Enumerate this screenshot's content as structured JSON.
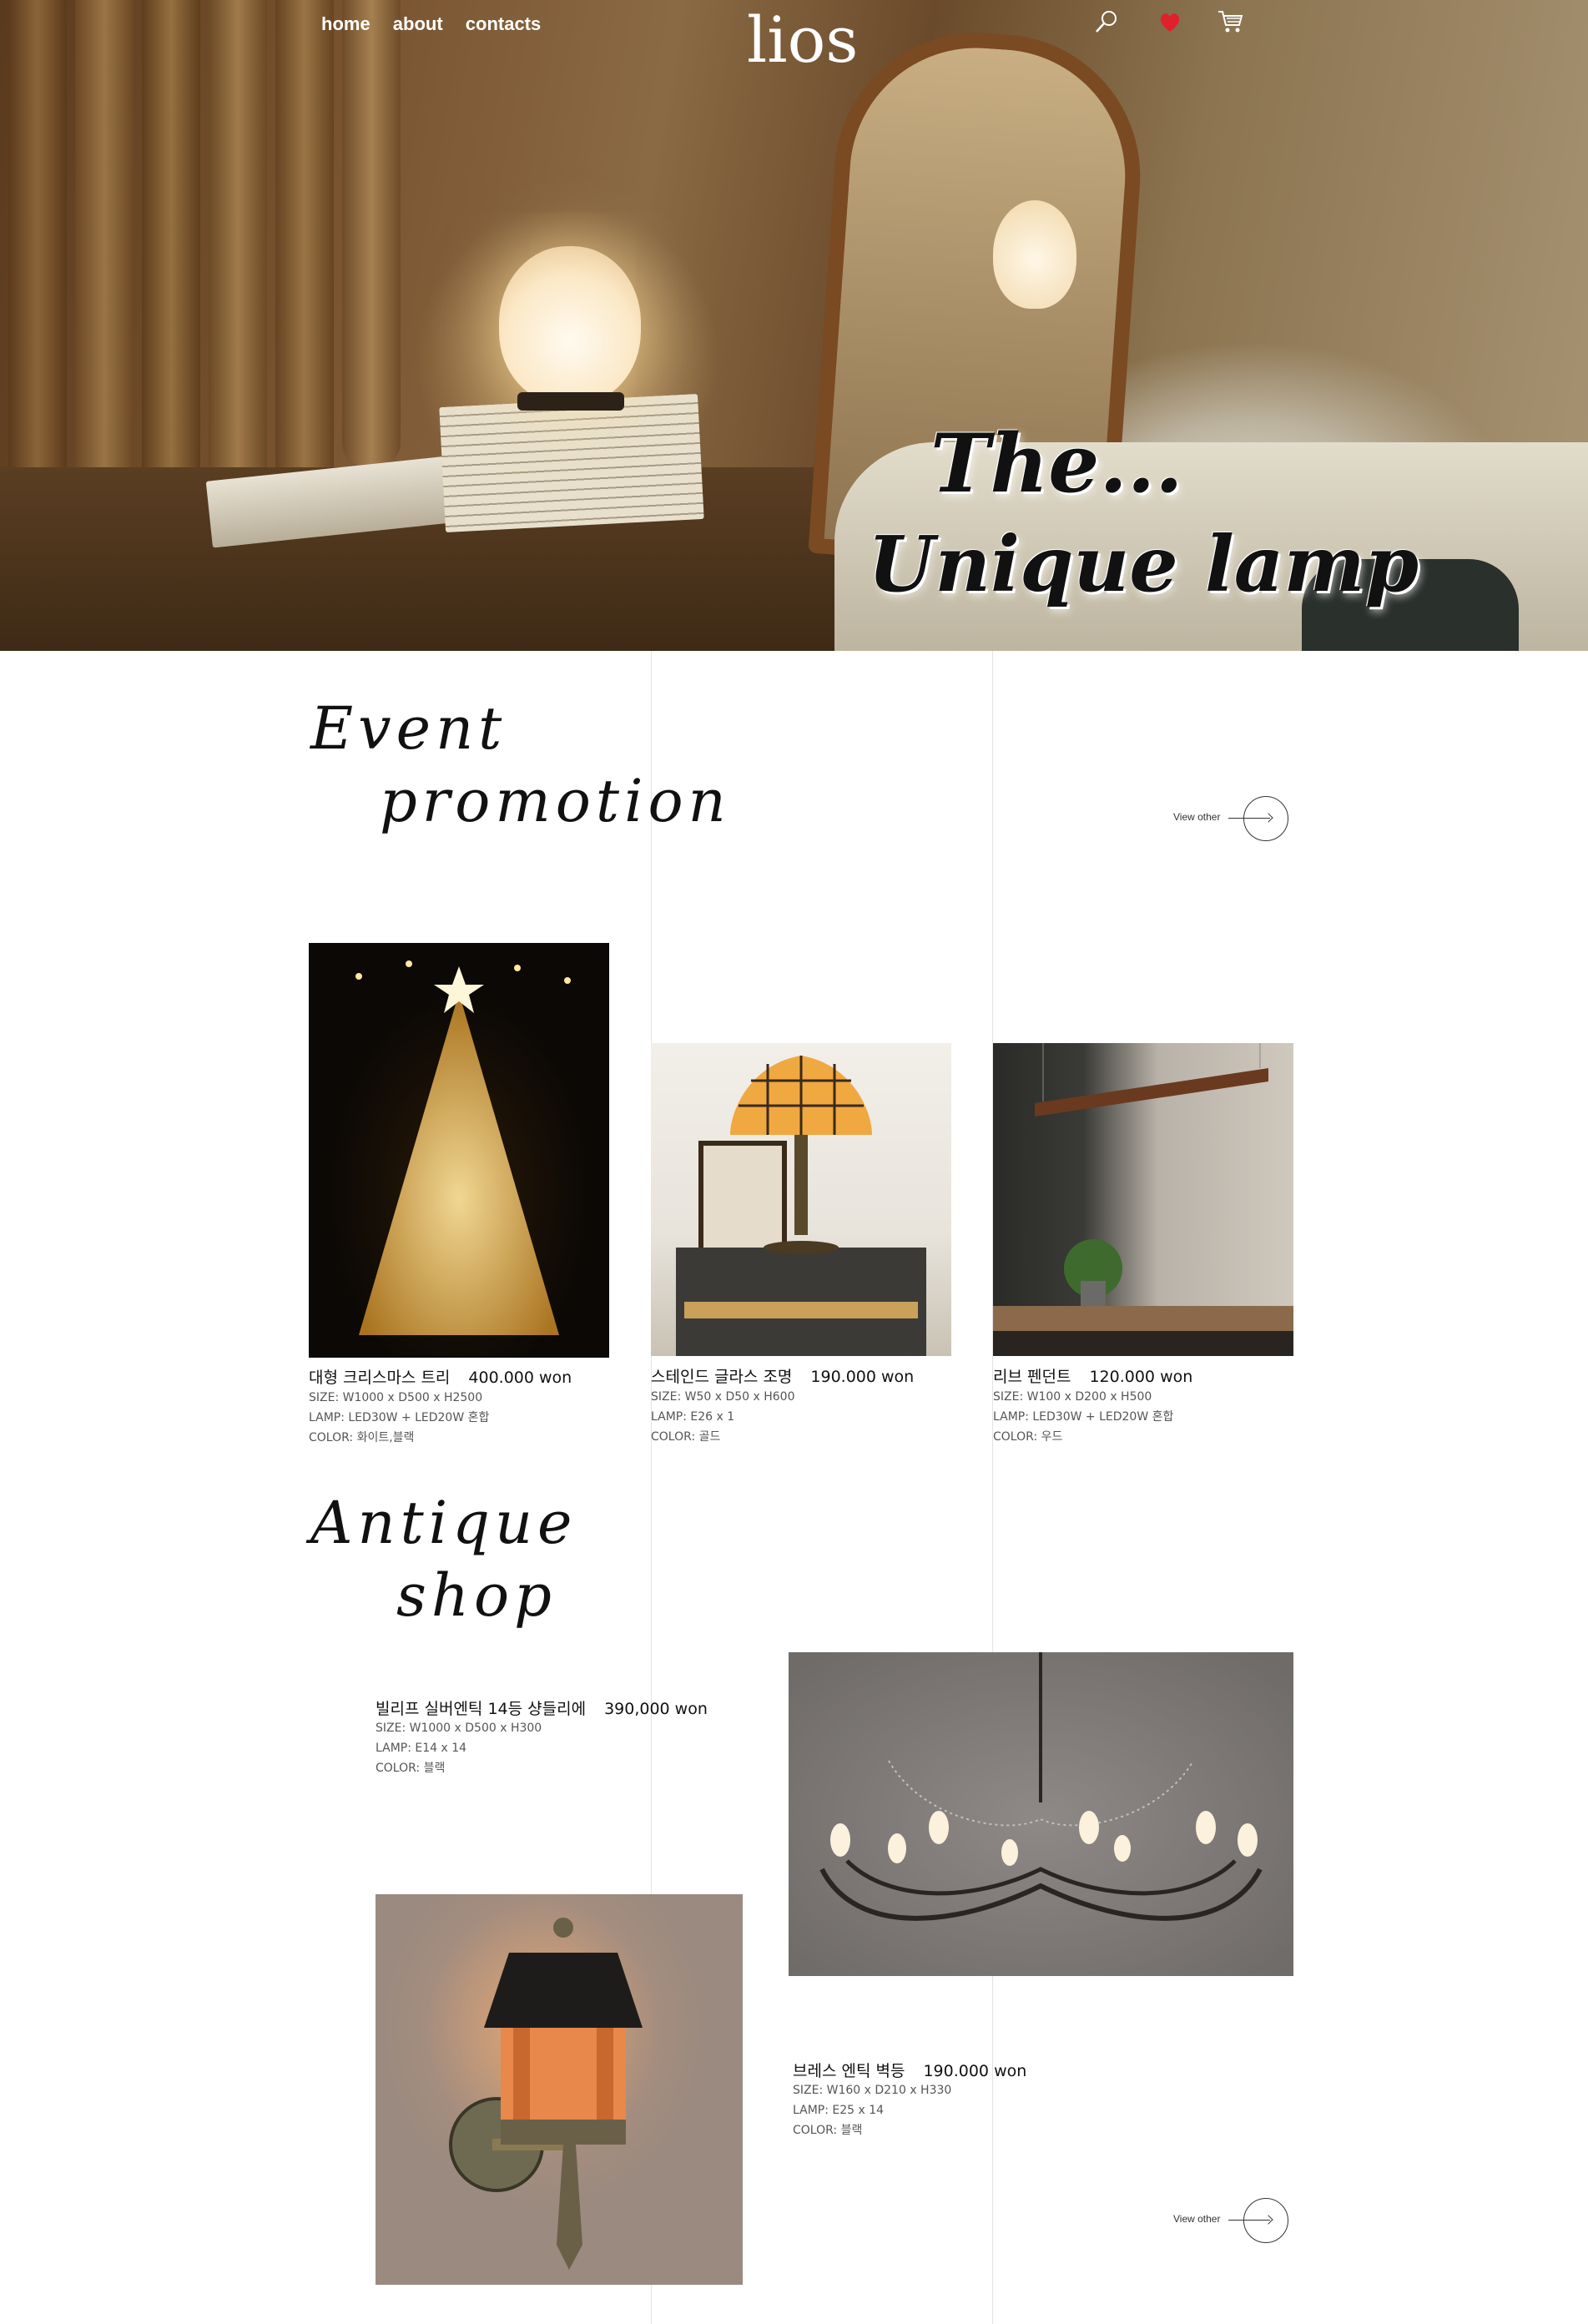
{
  "nav": {
    "home": "home",
    "about": "about",
    "contacts": "contacts"
  },
  "brand": "lios",
  "header_icons": [
    "search-icon",
    "heart-icon",
    "cart-icon"
  ],
  "hero": {
    "line1": "The...",
    "line2": "Unique lamp"
  },
  "event": {
    "title_line1": "Event",
    "title_line2": "promotion",
    "view_other": "View other",
    "products": [
      {
        "name": "대형 크리스마스 트리",
        "price": "400.000 won",
        "size": "SIZE: W1000 x D500 x H2500",
        "lamp": "LAMP: LED30W + LED20W 혼합",
        "color": "COLOR: 화이트,블랙"
      },
      {
        "name": "스테인드 글라스 조명",
        "price": "190.000 won",
        "size": "SIZE: W50 x D50 x H600",
        "lamp": "LAMP: E26 x 1",
        "color": "COLOR: 골드"
      },
      {
        "name": "리브 펜던트",
        "price": "120.000 won",
        "size": "SIZE: W100 x D200 x H500",
        "lamp": "LAMP: LED30W + LED20W 혼합",
        "color": "COLOR: 우드"
      }
    ]
  },
  "antique": {
    "title_line1": "Antique",
    "title_line2": "shop",
    "view_other": "View other",
    "products": [
      {
        "name": "빌리프 실버엔틱 14등 샹들리에",
        "price": "390,000 won",
        "size": "SIZE: W1000 x D500 x H300",
        "lamp": "LAMP: E14 x 14",
        "color": "COLOR: 블랙"
      },
      {
        "name": "브레스 엔틱 벽등",
        "price": "190.000 won",
        "size": "SIZE: W160 x D210 x H330",
        "lamp": "LAMP: E25 x 14",
        "color": "COLOR: 블랙"
      }
    ]
  },
  "colors": {
    "heart": "#e0202a",
    "accent_text": "#111111",
    "grid_line": "#e3e3e3"
  }
}
